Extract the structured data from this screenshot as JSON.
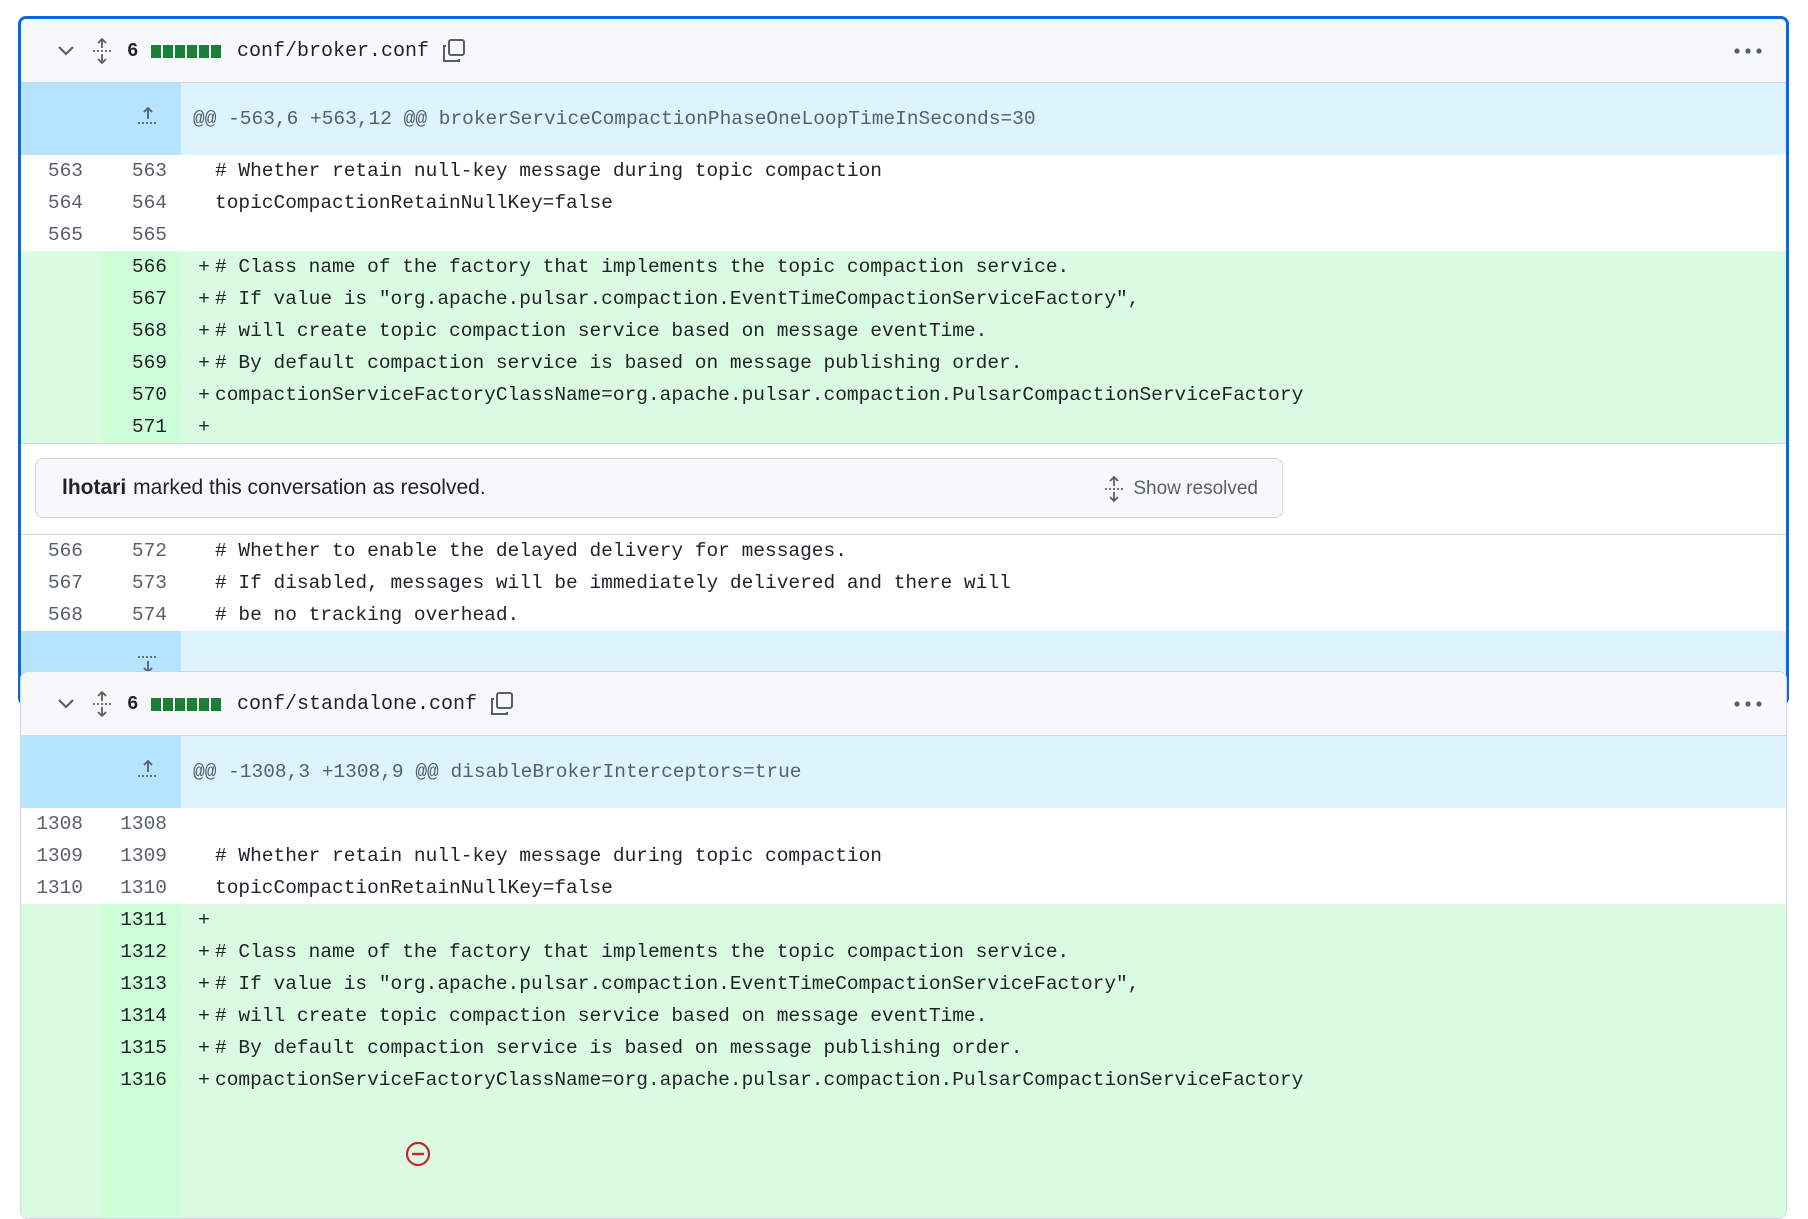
{
  "files": [
    {
      "change_count": "6",
      "filename": "conf/broker.conf",
      "hunk_header": "@@ -563,6 +563,12 @@ brokerServiceCompactionPhaseOneLoopTimeInSeconds=30",
      "lines_before": [
        {
          "old": "563",
          "new": "563",
          "sign": "",
          "text": "# Whether retain null-key message during topic compaction"
        },
        {
          "old": "564",
          "new": "564",
          "sign": "",
          "text": "topicCompactionRetainNullKey=false"
        },
        {
          "old": "565",
          "new": "565",
          "sign": "",
          "text": ""
        },
        {
          "old": "",
          "new": "566",
          "sign": "+",
          "text": "# Class name of the factory that implements the topic compaction service."
        },
        {
          "old": "",
          "new": "567",
          "sign": "+",
          "text": "# If value is \"org.apache.pulsar.compaction.EventTimeCompactionServiceFactory\","
        },
        {
          "old": "",
          "new": "568",
          "sign": "+",
          "text": "# will create topic compaction service based on message eventTime."
        },
        {
          "old": "",
          "new": "569",
          "sign": "+",
          "text": "# By default compaction service is based on message publishing order."
        },
        {
          "old": "",
          "new": "570",
          "sign": "+",
          "text": "compactionServiceFactoryClassName=org.apache.pulsar.compaction.PulsarCompactionServiceFactory"
        },
        {
          "old": "",
          "new": "571",
          "sign": "+",
          "text": ""
        }
      ],
      "resolved": {
        "user": "lhotari",
        "message": "marked this conversation as resolved.",
        "button": "Show resolved"
      },
      "lines_after": [
        {
          "old": "566",
          "new": "572",
          "sign": "",
          "text": "# Whether to enable the delayed delivery for messages."
        },
        {
          "old": "567",
          "new": "573",
          "sign": "",
          "text": "# If disabled, messages will be immediately delivered and there will"
        },
        {
          "old": "568",
          "new": "574",
          "sign": "",
          "text": "# be no tracking overhead."
        }
      ]
    },
    {
      "change_count": "6",
      "filename": "conf/standalone.conf",
      "hunk_header": "@@ -1308,3 +1308,9 @@ disableBrokerInterceptors=true",
      "lines_before": [
        {
          "old": "1308",
          "new": "1308",
          "sign": "",
          "text": ""
        },
        {
          "old": "1309",
          "new": "1309",
          "sign": "",
          "text": "# Whether retain null-key message during topic compaction"
        },
        {
          "old": "1310",
          "new": "1310",
          "sign": "",
          "text": "topicCompactionRetainNullKey=false"
        },
        {
          "old": "",
          "new": "1311",
          "sign": "+",
          "text": ""
        },
        {
          "old": "",
          "new": "1312",
          "sign": "+",
          "text": "# Class name of the factory that implements the topic compaction service."
        },
        {
          "old": "",
          "new": "1313",
          "sign": "+",
          "text": "# If value is \"org.apache.pulsar.compaction.EventTimeCompactionServiceFactory\","
        },
        {
          "old": "",
          "new": "1314",
          "sign": "+",
          "text": "# will create topic compaction service based on message eventTime."
        },
        {
          "old": "",
          "new": "1315",
          "sign": "+",
          "text": "# By default compaction service is based on message publishing order."
        },
        {
          "old": "",
          "new": "1316",
          "sign": "+",
          "text": "compactionServiceFactoryClassName=org.apache.pulsar.compaction.PulsarCompactionServiceFactory"
        }
      ]
    }
  ],
  "colors": {
    "added_bg": "#dafbe1",
    "hunk_bg": "#ddf4ff",
    "active_border": "#0969da",
    "diffstat_green": "#1a7f37",
    "blocker_red": "#cf222e"
  }
}
